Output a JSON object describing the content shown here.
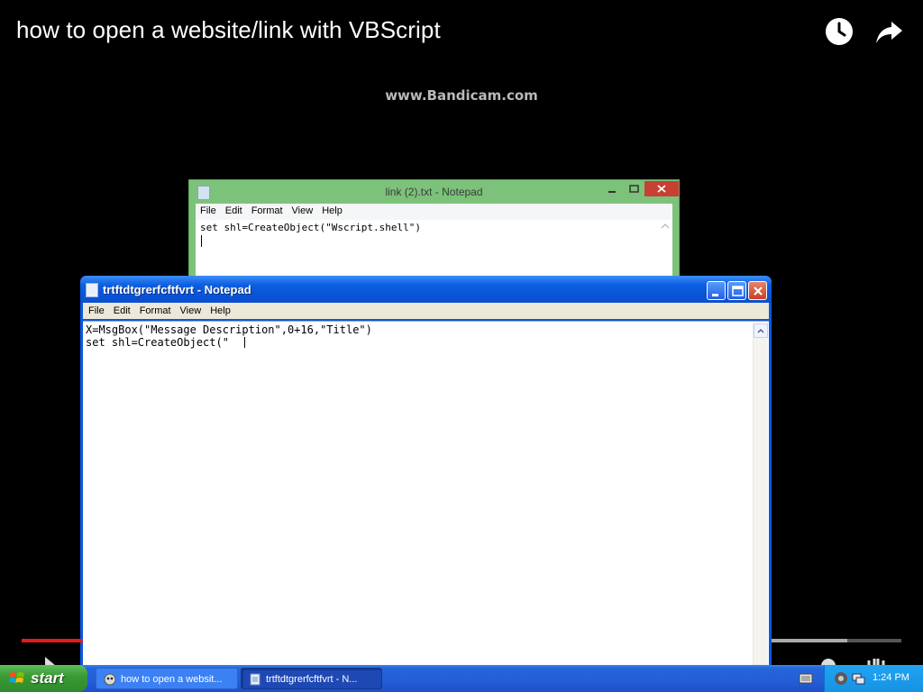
{
  "video": {
    "title": "how to open a website/link with VBScript",
    "watermark": "www.Bandicam.com",
    "watch_later_icon": "clock-icon",
    "share_icon": "share-arrow-icon",
    "progress_played_color": "#e51a1a"
  },
  "back_notepad": {
    "title": "link (2).txt - Notepad",
    "menu": [
      "File",
      "Edit",
      "Format",
      "View",
      "Help"
    ],
    "text": "set shl=CreateObject(\"Wscript.shell\")"
  },
  "front_notepad": {
    "title": "trtftdtgrerfcftfvrt - Notepad",
    "menu": [
      "File",
      "Edit",
      "Format",
      "View",
      "Help"
    ],
    "lines": [
      "X=MsgBox(\"Message Description\",0+16,\"Title\")",
      "set shl=CreateObject(\""
    ]
  },
  "taskbar": {
    "start_label": "start",
    "tasks": [
      {
        "label": "how to open a websit...",
        "icon": "media-player-icon",
        "active": false
      },
      {
        "label": "trtftdtgrerfcftfvrt - N...",
        "icon": "notepad-icon",
        "active": true
      }
    ],
    "clock": "1:24 PM"
  }
}
